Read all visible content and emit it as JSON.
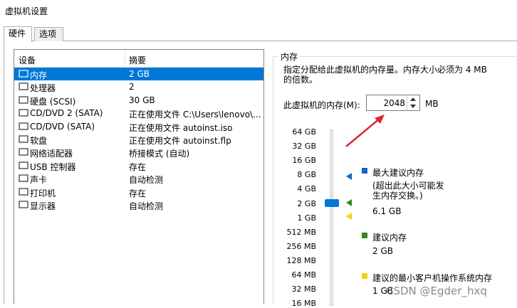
{
  "window": {
    "title": "虚拟机设置"
  },
  "tabs": [
    {
      "label": "硬件"
    },
    {
      "label": "选项"
    }
  ],
  "device_list": {
    "headers": [
      "设备",
      "摘要"
    ],
    "rows": [
      {
        "device": "内存",
        "summary": "2 GB",
        "icon": "memory-icon"
      },
      {
        "device": "处理器",
        "summary": "2",
        "icon": "cpu-icon"
      },
      {
        "device": "硬盘 (SCSI)",
        "summary": "30 GB",
        "icon": "disk-icon"
      },
      {
        "device": "CD/DVD 2 (SATA)",
        "summary": "正在使用文件 C:\\Users\\lenovo\\...",
        "icon": "cd-icon"
      },
      {
        "device": "CD/DVD (SATA)",
        "summary": "正在使用文件 autoinst.iso",
        "icon": "cd-icon"
      },
      {
        "device": "软盘",
        "summary": "正在使用文件 autoinst.flp",
        "icon": "floppy-icon"
      },
      {
        "device": "网络适配器",
        "summary": "桥接模式 (自动)",
        "icon": "network-icon"
      },
      {
        "device": "USB 控制器",
        "summary": "存在",
        "icon": "usb-icon"
      },
      {
        "device": "声卡",
        "summary": "自动检测",
        "icon": "sound-icon"
      },
      {
        "device": "打印机",
        "summary": "存在",
        "icon": "printer-icon"
      },
      {
        "device": "显示器",
        "summary": "自动检测",
        "icon": "monitor-icon"
      }
    ],
    "selected_index": 0
  },
  "memory": {
    "group_title": "内存",
    "description": "指定分配给此虚拟机的内存量。内存大小必须为 4 MB 的倍数。",
    "field_label": "此虚拟机的内存(M):",
    "value": "2048",
    "unit": "MB",
    "scale": [
      "64 GB",
      "32 GB",
      "16 GB",
      "8 GB",
      "4 GB",
      "2 GB",
      "1 GB",
      "512 MB",
      "256 MB",
      "128 MB",
      "64 MB",
      "32 MB",
      "16 MB"
    ],
    "legend": [
      {
        "title": "最大建议内存",
        "note": "(超出此大小可能发生内存交换。)",
        "value": "6.1 GB",
        "color": "#1565c0"
      },
      {
        "title": "建议内存",
        "note": "",
        "value": "2 GB",
        "color": "#2e8b1e"
      },
      {
        "title": "建议的最小客户机操作系统内存",
        "note": "",
        "value": "1 GB",
        "color": "#f2d300"
      }
    ]
  },
  "watermark": "CSDN @Egder_hxq"
}
